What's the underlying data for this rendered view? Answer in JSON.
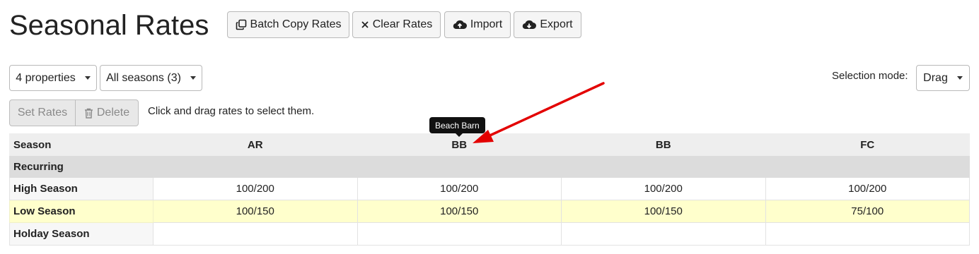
{
  "page": {
    "title": "Seasonal Rates"
  },
  "toolbar": {
    "batch_copy": "Batch Copy Rates",
    "clear": "Clear Rates",
    "import": "Import",
    "export": "Export"
  },
  "filters": {
    "properties": "4 properties",
    "seasons": "All seasons (3)"
  },
  "selection": {
    "label": "Selection mode:",
    "value": "Drag"
  },
  "actions": {
    "set_rates": "Set Rates",
    "delete": "Delete",
    "hint": "Click and drag rates to select them."
  },
  "tooltip": "Beach Barn",
  "table": {
    "season_header": "Season",
    "columns": [
      "AR",
      "BB",
      "BB",
      "FC"
    ],
    "group": "Recurring",
    "rows": [
      {
        "name": "High Season",
        "values": [
          "100/200",
          "100/200",
          "100/200",
          "100/200"
        ]
      },
      {
        "name": "Low Season",
        "values": [
          "100/150",
          "100/150",
          "100/150",
          "75/100"
        ]
      },
      {
        "name": "Holday Season",
        "values": [
          "",
          "",
          "",
          ""
        ]
      }
    ]
  },
  "colors": {
    "highlight_row": "#ffffcc",
    "annotation_arrow": "#e30000"
  },
  "icons": {
    "batch_copy": "copy-icon",
    "clear": "x-icon",
    "import": "cloud-upload-icon",
    "export": "cloud-download-icon",
    "delete": "trash-icon"
  }
}
